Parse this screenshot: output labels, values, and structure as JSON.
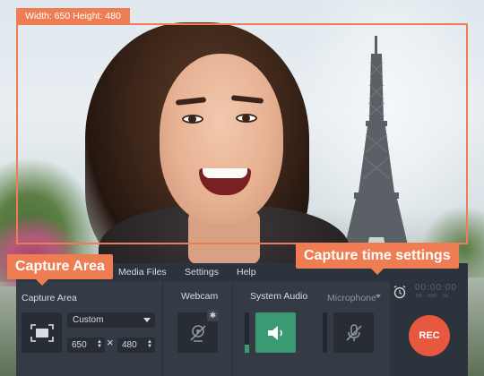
{
  "capture_frame": {
    "dimensions_label": "Width: 650  Height: 480"
  },
  "menu": {
    "items": [
      "Media Files",
      "Settings",
      "Help"
    ]
  },
  "callouts": {
    "capture_area": "Capture Area",
    "capture_time": "Capture time settings"
  },
  "capture_area": {
    "label": "Capture Area",
    "preset": "Custom",
    "width": "650",
    "height": "480",
    "separator": "×"
  },
  "webcam": {
    "label": "Webcam",
    "enabled": false
  },
  "system_audio": {
    "label": "System Audio",
    "enabled": true,
    "level": 0.2
  },
  "microphone": {
    "label": "Microphone",
    "enabled": false,
    "level": 0.0
  },
  "timer": {
    "value": "00:00:00",
    "units": "hh mm ss"
  },
  "rec_button": {
    "label": "REC"
  },
  "colors": {
    "accent": "#ef7d53",
    "panel": "#353b45",
    "green": "#3a9a73",
    "rec": "#e8583f"
  }
}
